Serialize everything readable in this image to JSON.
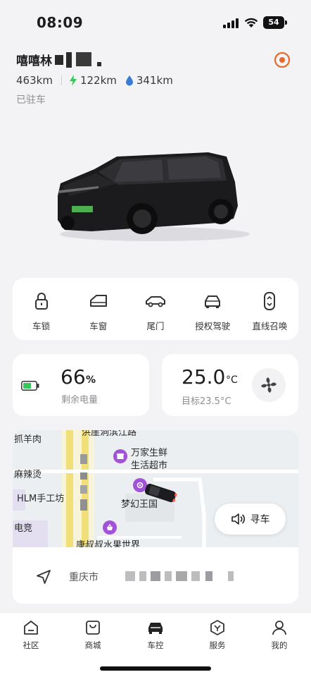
{
  "status_bar": {
    "time": "08:09",
    "battery": "54"
  },
  "header": {
    "car_name": "嘻嘻林",
    "total_range": "463km",
    "ev_range": "122km",
    "fuel_range": "341km",
    "parked_status": "已驻车"
  },
  "controls": [
    {
      "label": "车锁",
      "icon": "lock-icon"
    },
    {
      "label": "车窗",
      "icon": "window-icon"
    },
    {
      "label": "尾门",
      "icon": "tailgate-icon"
    },
    {
      "label": "授权驾驶",
      "icon": "authorized-driving-icon"
    },
    {
      "label": "直线召唤",
      "icon": "summon-icon"
    }
  ],
  "battery_card": {
    "value": "66",
    "unit": "%",
    "label": "剩余电量",
    "level": 0.66
  },
  "climate_card": {
    "value": "25.0",
    "unit": "°C",
    "target": "目标23.5°C"
  },
  "map": {
    "labels": {
      "yang_rou": "抓羊肉",
      "top_road": "洪崖洞滨江路",
      "mala": "麻辣烫",
      "hlm": "HLM手工坊",
      "dian_jing": "电竞",
      "supermarket_line1": "万家生鲜",
      "supermarket_line2": "生活超市",
      "dream_kingdom": "梦幻王国",
      "fruit_world": "康叔叔水果世界"
    },
    "find_car_label": "寻车"
  },
  "address": {
    "city": "重庆市"
  },
  "tabs": [
    {
      "label": "社区",
      "icon": "community-icon"
    },
    {
      "label": "商城",
      "icon": "store-icon"
    },
    {
      "label": "车控",
      "icon": "car-control-icon",
      "active": true
    },
    {
      "label": "服务",
      "icon": "service-icon"
    },
    {
      "label": "我的",
      "icon": "profile-icon"
    }
  ],
  "colors": {
    "accent": "#e56a2c",
    "ev_green": "#34c759",
    "fuel_blue": "#3a7bd5",
    "poi_purple": "#a152d6"
  }
}
